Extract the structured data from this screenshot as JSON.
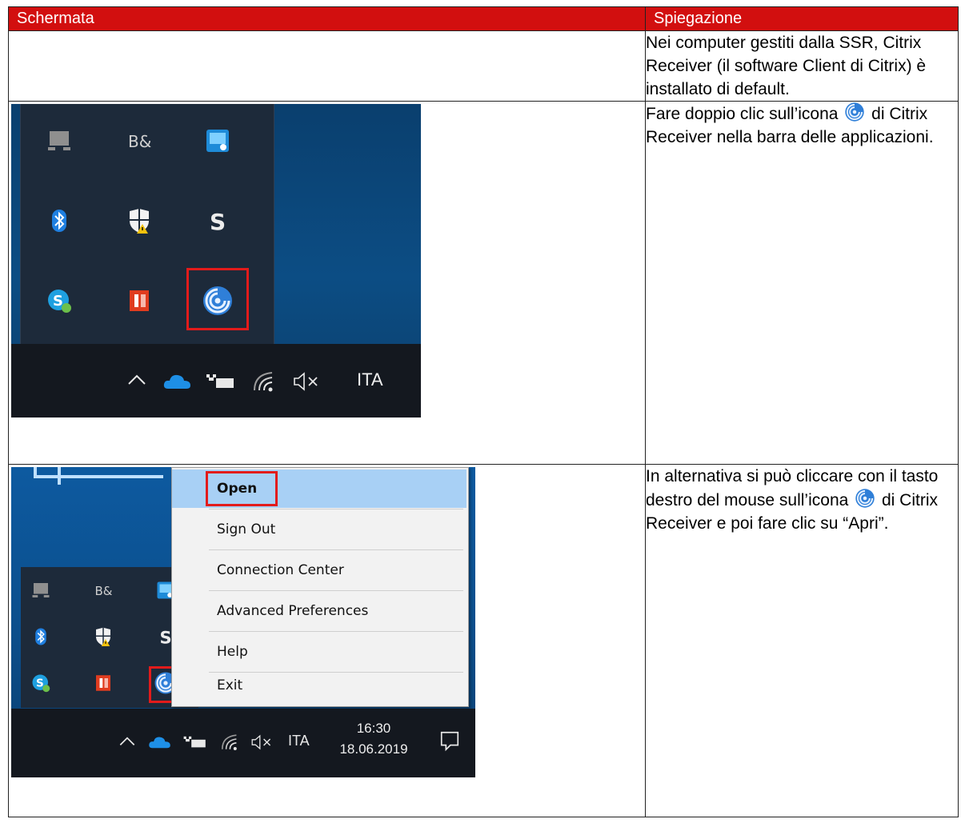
{
  "header": {
    "col_left": "Schermata",
    "col_right": "Spiegazione"
  },
  "row1": {
    "text": "Nei computer gestiti dalla SSR, Citrix Receiver (il software Client di Citrix) è installato di default."
  },
  "row2": {
    "text_before": "Fare doppio clic sull’icona",
    "text_after": "di Citrix Receiver nella barra delle applicazioni.",
    "taskbar": {
      "language": "ITA"
    }
  },
  "row3": {
    "text_before": "In alternativa si può cliccare con il tasto destro del mouse sull’icona",
    "text_after": "di Citrix Receiver e poi fare clic su “Apri”.",
    "context_menu": {
      "items": [
        {
          "label": "Open"
        },
        {
          "label": "Sign Out"
        },
        {
          "label": "Connection Center"
        },
        {
          "label": "Advanced Preferences"
        },
        {
          "label": "Help"
        },
        {
          "label": "Exit"
        }
      ]
    },
    "taskbar": {
      "language": "ITA",
      "time": "16:30",
      "date": "18.06.2019"
    }
  },
  "colors": {
    "header_bg": "#d20f0f",
    "highlight": "#e21b1b",
    "citrix_blue": "#2f7fd8"
  }
}
